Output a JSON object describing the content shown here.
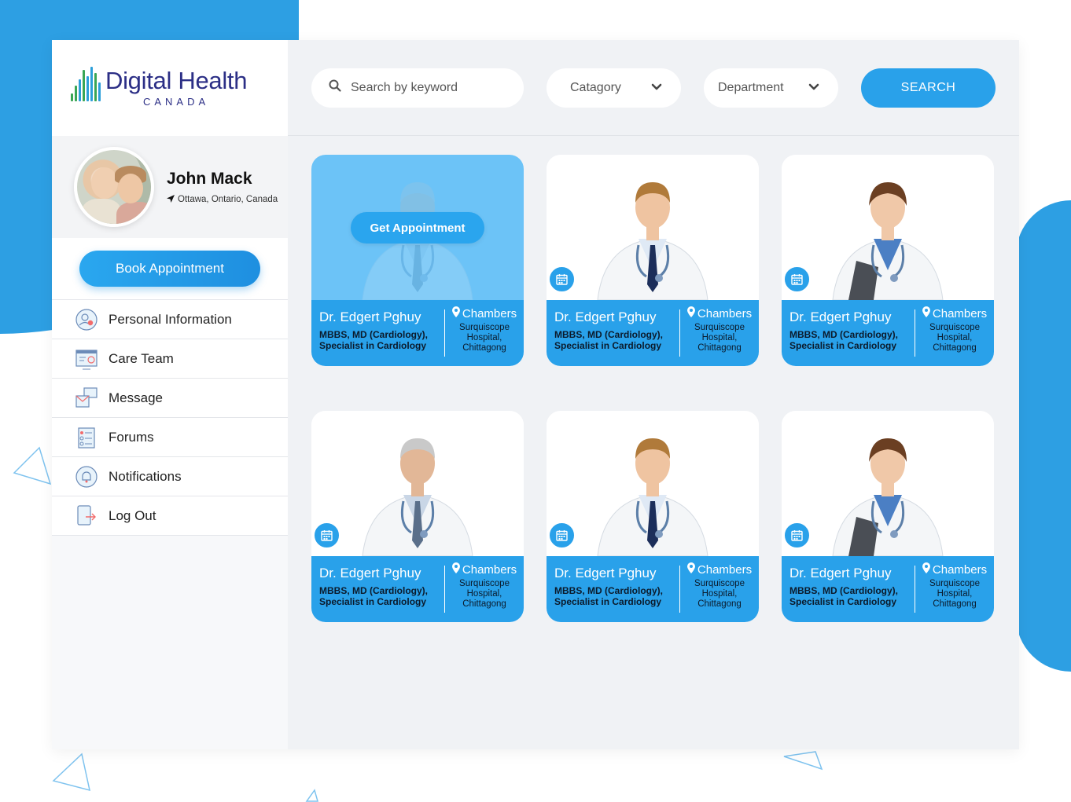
{
  "brand": {
    "name": "Digital Health",
    "country": "CANADA",
    "colors": {
      "primary": "#29a1ea",
      "navy": "#2c2f86",
      "green": "#3aa655"
    }
  },
  "user": {
    "name": "John Mack",
    "location": "Ottawa, Ontario, Canada"
  },
  "sidebar": {
    "book_label": "Book Appointment",
    "items": [
      {
        "label": "Personal Information",
        "icon": "user-profile-icon"
      },
      {
        "label": "Care Team",
        "icon": "care-team-icon"
      },
      {
        "label": "Message",
        "icon": "message-icon"
      },
      {
        "label": "Forums",
        "icon": "forums-icon"
      },
      {
        "label": "Notifications",
        "icon": "notifications-icon"
      },
      {
        "label": "Log Out",
        "icon": "logout-icon"
      }
    ]
  },
  "toolbar": {
    "search_placeholder": "Search by keyword",
    "category_label": "Catagory",
    "department_label": "Department",
    "search_button": "SEARCH"
  },
  "cards": [
    {
      "name": "Dr.  Edgert Pghuy",
      "qual1": "MBBS, MD (Cardiology),",
      "qual2": "Specialist in Cardiology",
      "chambers": "Chambers",
      "hospital1": "Surquiscope",
      "hospital2": "Hospital,",
      "hospital3": "Chittagong",
      "overlay": "Get Appointment",
      "photo": "senior-male-doctor"
    },
    {
      "name": "Dr.  Edgert Pghuy",
      "qual1": "MBBS, MD (Cardiology),",
      "qual2": "Specialist in Cardiology",
      "chambers": "Chambers",
      "hospital1": "Surquiscope",
      "hospital2": "Hospital,",
      "hospital3": "Chittagong",
      "photo": "young-male-doctor"
    },
    {
      "name": "Dr.  Edgert Pghuy",
      "qual1": "MBBS, MD (Cardiology),",
      "qual2": "Specialist in Cardiology",
      "chambers": "Chambers",
      "hospital1": "Surquiscope",
      "hospital2": "Hospital,",
      "hospital3": "Chittagong",
      "photo": "female-doctor"
    },
    {
      "name": "Dr.  Edgert Pghuy",
      "qual1": "MBBS, MD (Cardiology),",
      "qual2": "Specialist in Cardiology",
      "chambers": "Chambers",
      "hospital1": "Surquiscope",
      "hospital2": "Hospital,",
      "hospital3": "Chittagong",
      "photo": "senior-male-doctor"
    },
    {
      "name": "Dr.  Edgert Pghuy",
      "qual1": "MBBS, MD (Cardiology),",
      "qual2": "Specialist in Cardiology",
      "chambers": "Chambers",
      "hospital1": "Surquiscope",
      "hospital2": "Hospital,",
      "hospital3": "Chittagong",
      "photo": "young-male-doctor"
    },
    {
      "name": "Dr.  Edgert Pghuy",
      "qual1": "MBBS, MD (Cardiology),",
      "qual2": "Specialist in Cardiology",
      "chambers": "Chambers",
      "hospital1": "Surquiscope",
      "hospital2": "Hospital,",
      "hospital3": "Chittagong",
      "photo": "female-doctor"
    }
  ]
}
